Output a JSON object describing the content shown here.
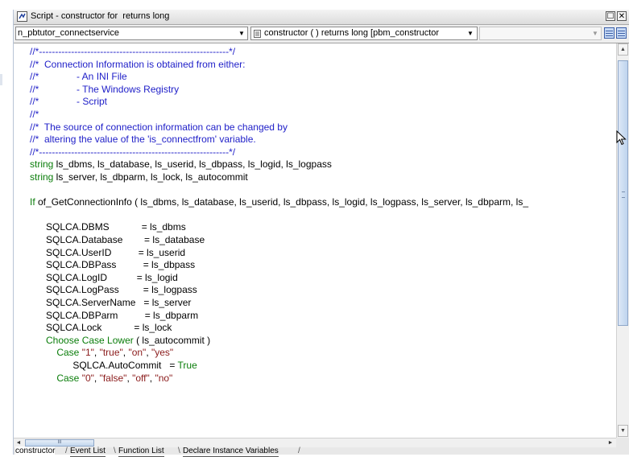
{
  "window": {
    "title": "Script - constructor for  returns long",
    "minimize_glyph": "☐",
    "close_glyph": "✕",
    "title_icon": "script-icon"
  },
  "toolbar": {
    "object_select": "n_pbtutor_connectservice",
    "event_select": "constructor ( ) returns long [pbm_constructor",
    "event_icon": "event-doc-icon",
    "ancestor_select": "",
    "buttons": [
      "layout-grid-icon",
      "layout-list-icon"
    ]
  },
  "code": [
    {
      "parts": [
        {
          "c": "cm",
          "t": "//*-----------------------------------------------------------*/"
        }
      ]
    },
    {
      "parts": [
        {
          "c": "cm",
          "t": "//*  Connection Information is obtained from either:"
        }
      ]
    },
    {
      "parts": [
        {
          "c": "cm",
          "t": "//*              - An INI File"
        }
      ]
    },
    {
      "parts": [
        {
          "c": "cm",
          "t": "//*              - The Windows Registry"
        }
      ]
    },
    {
      "parts": [
        {
          "c": "cm",
          "t": "//*              - Script"
        }
      ]
    },
    {
      "parts": [
        {
          "c": "cm",
          "t": "//*"
        }
      ]
    },
    {
      "parts": [
        {
          "c": "cm",
          "t": "//*  The source of connection information can be changed by"
        }
      ]
    },
    {
      "parts": [
        {
          "c": "cm",
          "t": "//*  altering the value of the 'is_connectfrom' variable."
        }
      ]
    },
    {
      "parts": [
        {
          "c": "cm",
          "t": "//*-----------------------------------------------------------*/"
        }
      ]
    },
    {
      "parts": [
        {
          "c": "kw",
          "t": "string"
        },
        {
          "c": "",
          "t": " ls_dbms, ls_database, ls_userid, ls_dbpass, ls_logid, ls_logpass"
        }
      ]
    },
    {
      "parts": [
        {
          "c": "kw",
          "t": "string"
        },
        {
          "c": "",
          "t": " ls_server, ls_dbparm, ls_lock, ls_autocommit"
        }
      ]
    },
    {
      "parts": [
        {
          "c": "",
          "t": ""
        }
      ]
    },
    {
      "parts": [
        {
          "c": "kw",
          "t": "If"
        },
        {
          "c": "",
          "t": " of_GetConnectionInfo ( ls_dbms, ls_database, ls_userid, ls_dbpass, ls_logid, ls_logpass, ls_server, ls_dbparm, ls_"
        }
      ]
    },
    {
      "parts": [
        {
          "c": "",
          "t": ""
        }
      ]
    },
    {
      "parts": [
        {
          "c": "",
          "t": "      SQLCA.DBMS            = ls_dbms"
        }
      ]
    },
    {
      "parts": [
        {
          "c": "",
          "t": "      SQLCA.Database        = ls_database"
        }
      ]
    },
    {
      "parts": [
        {
          "c": "",
          "t": "      SQLCA.UserID          = ls_userid"
        }
      ]
    },
    {
      "parts": [
        {
          "c": "",
          "t": "      SQLCA.DBPass          = ls_dbpass"
        }
      ]
    },
    {
      "parts": [
        {
          "c": "",
          "t": "      SQLCA.LogID           = ls_logid"
        }
      ]
    },
    {
      "parts": [
        {
          "c": "",
          "t": "      SQLCA.LogPass         = ls_logpass"
        }
      ]
    },
    {
      "parts": [
        {
          "c": "",
          "t": "      SQLCA.ServerName   = ls_server"
        }
      ]
    },
    {
      "parts": [
        {
          "c": "",
          "t": "      SQLCA.DBParm          = ls_dbparm"
        }
      ]
    },
    {
      "parts": [
        {
          "c": "",
          "t": "      SQLCA.Lock            = ls_lock"
        }
      ]
    },
    {
      "parts": [
        {
          "c": "",
          "t": "      "
        },
        {
          "c": "kw",
          "t": "Choose Case Lower"
        },
        {
          "c": "",
          "t": " ( ls_autocommit )"
        }
      ]
    },
    {
      "parts": [
        {
          "c": "",
          "t": "          "
        },
        {
          "c": "kw",
          "t": "Case"
        },
        {
          "c": "",
          "t": " "
        },
        {
          "c": "st",
          "t": "\"1\""
        },
        {
          "c": "",
          "t": ", "
        },
        {
          "c": "st",
          "t": "\"true\""
        },
        {
          "c": "",
          "t": ", "
        },
        {
          "c": "st",
          "t": "\"on\""
        },
        {
          "c": "",
          "t": ", "
        },
        {
          "c": "st",
          "t": "\"yes\""
        }
      ]
    },
    {
      "parts": [
        {
          "c": "",
          "t": "                SQLCA.AutoCommit   = "
        },
        {
          "c": "kw",
          "t": "True"
        }
      ]
    },
    {
      "parts": [
        {
          "c": "",
          "t": "          "
        },
        {
          "c": "kw",
          "t": "Case"
        },
        {
          "c": "",
          "t": " "
        },
        {
          "c": "st",
          "t": "\"0\""
        },
        {
          "c": "",
          "t": ", "
        },
        {
          "c": "st",
          "t": "\"false\""
        },
        {
          "c": "",
          "t": ", "
        },
        {
          "c": "st",
          "t": "\"off\""
        },
        {
          "c": "",
          "t": ", "
        },
        {
          "c": "st",
          "t": "\"no\""
        }
      ]
    }
  ],
  "hscroll": {
    "left_glyph": "◄",
    "right_glyph": "►",
    "thumb_grip": "III"
  },
  "vscroll": {
    "up_glyph": "▲",
    "down_glyph": "▼"
  },
  "tabs": [
    "constructor",
    "Event List",
    "Function List",
    "Declare Instance Variables"
  ],
  "active_tab": "constructor",
  "colors": {
    "comment": "#1e1ec8",
    "keyword": "#0a7d0a",
    "string": "#8a1a1a"
  }
}
